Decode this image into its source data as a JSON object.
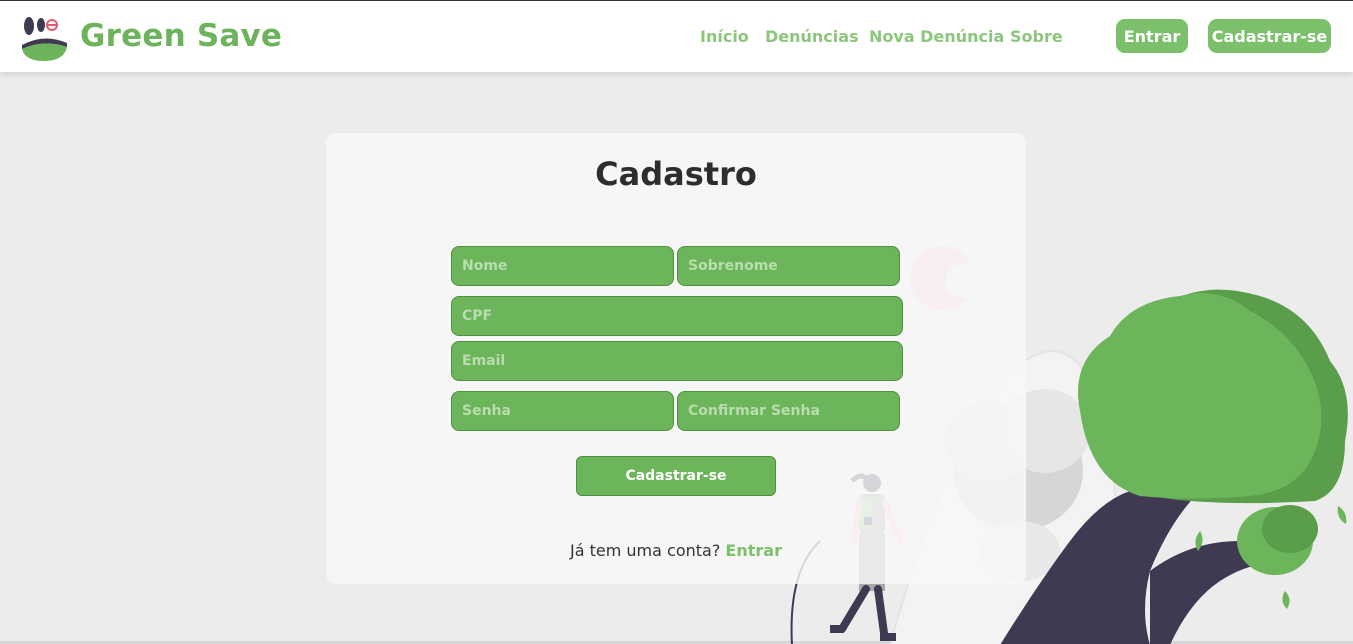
{
  "header": {
    "brand": "Green Save",
    "nav": {
      "inicio": "Início",
      "denuncias": "Denúncias",
      "nova_denuncia": "Nova Denúncia",
      "sobre": "Sobre"
    },
    "login_button": "Entrar",
    "signup_button": "Cadastrar-se"
  },
  "form": {
    "title": "Cadastro",
    "fields": {
      "nome": "Nome",
      "sobrenome": "Sobrenome",
      "cpf": "CPF",
      "email": "Email",
      "senha": "Senha",
      "confirmar_senha": "Confirmar Senha"
    },
    "submit": "Cadastrar-se",
    "have_account": "Já tem uma conta?",
    "login_link": "Entrar"
  },
  "colors": {
    "brand_green": "#6db35b",
    "field_green": "#6db55b",
    "tree_dark": "#3f3a52",
    "accent_pink": "#ffc1cc",
    "background": "#ececec"
  }
}
